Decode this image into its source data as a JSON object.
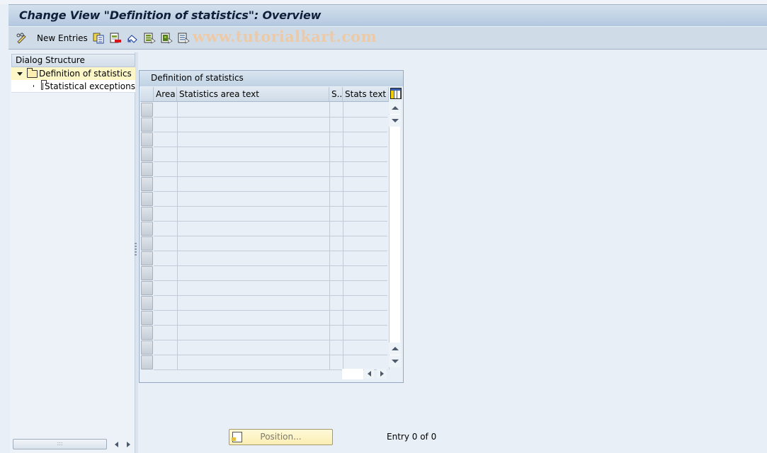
{
  "window": {
    "title": "Change View \"Definition of statistics\": Overview"
  },
  "toolbar": {
    "items": [
      {
        "name": "change-display-icon",
        "label": ""
      },
      {
        "name": "new-entries",
        "label": "New Entries"
      },
      {
        "name": "copy-as-icon",
        "label": ""
      },
      {
        "name": "delete-icon",
        "label": ""
      },
      {
        "name": "undo-change-icon",
        "label": ""
      },
      {
        "name": "select-all-icon",
        "label": ""
      },
      {
        "name": "select-block-icon",
        "label": ""
      },
      {
        "name": "deselect-all-icon",
        "label": ""
      }
    ],
    "watermark": "www.tutorialkart.com"
  },
  "dialog_structure": {
    "header": "Dialog Structure",
    "items": [
      {
        "label": "Definition of statistics",
        "expanded": true,
        "selected": true
      },
      {
        "label": "Statistical exceptions",
        "expanded": false,
        "selected": false
      }
    ]
  },
  "table": {
    "title": "Definition of statistics",
    "columns": [
      "Area",
      "Statistics area text",
      "S..",
      "Stats text"
    ],
    "rows": [],
    "visible_empty_rows": 18
  },
  "footer": {
    "position_button": "Position...",
    "entry_info": "Entry 0 of 0"
  },
  "colors": {
    "title_bar": "#b3c8df",
    "toolbar": "#cfdce8",
    "background": "#e9eff6",
    "selected_tree_row": "#fdf7c8",
    "position_button": "#fbeeb4"
  }
}
